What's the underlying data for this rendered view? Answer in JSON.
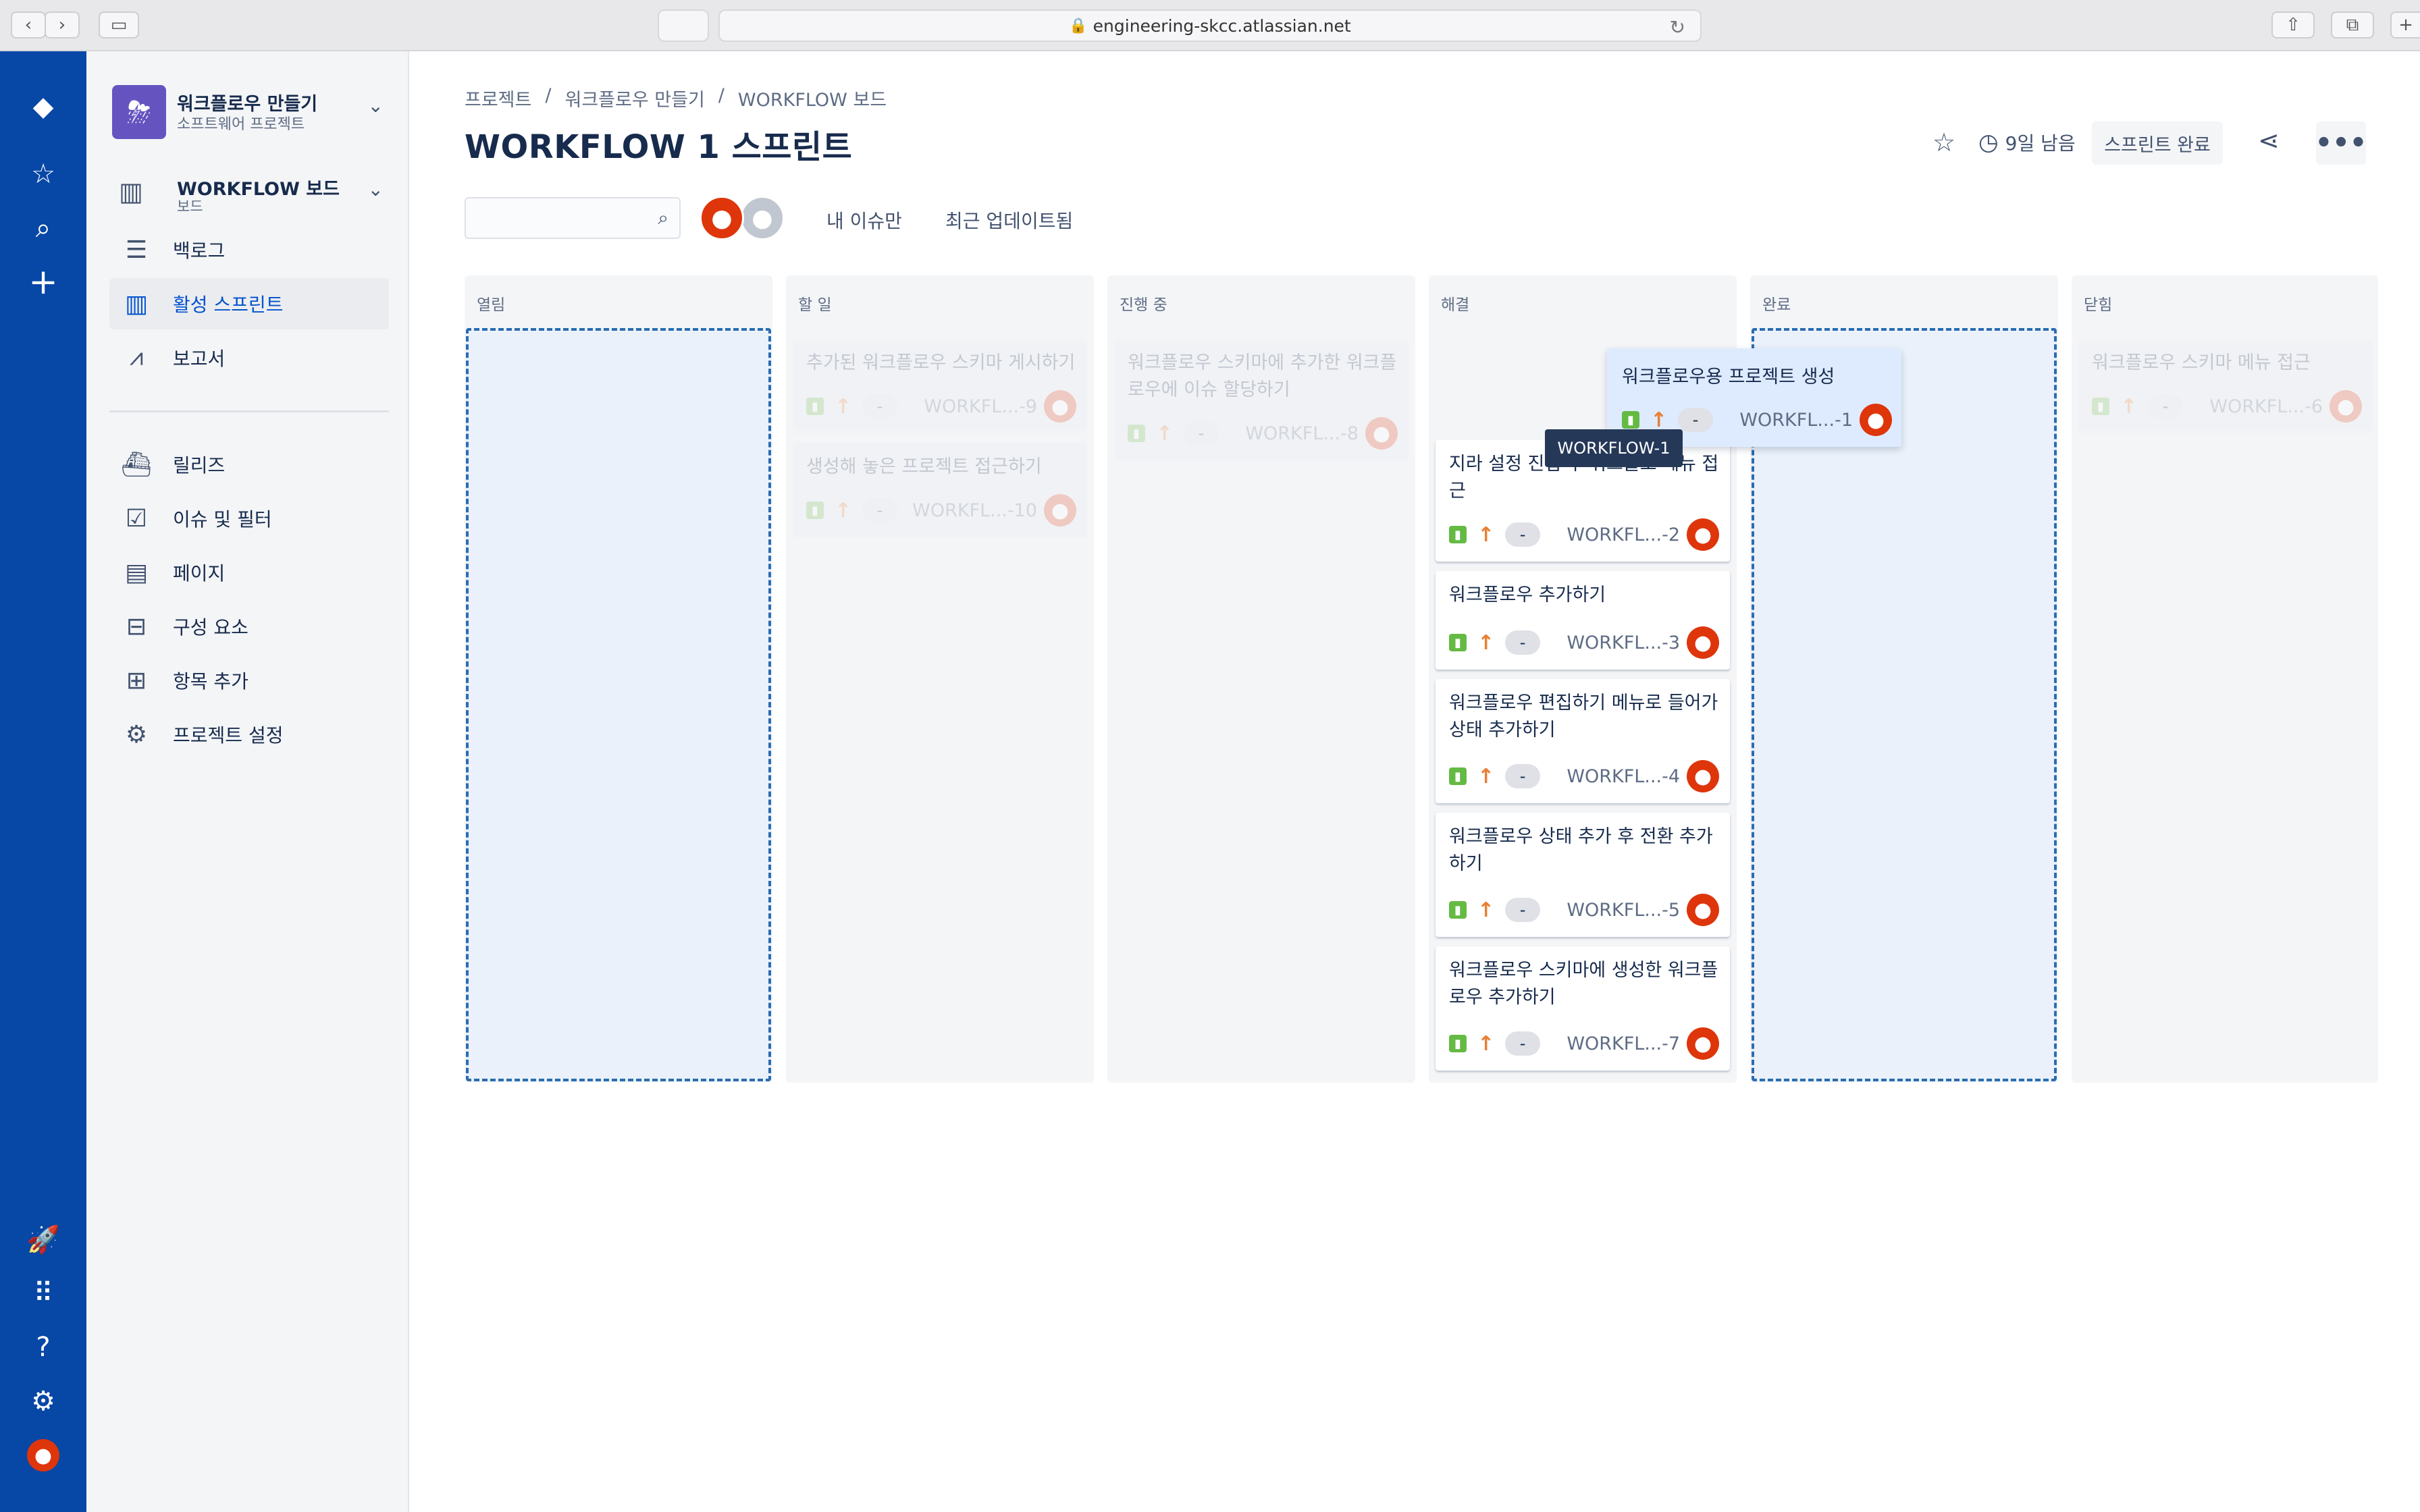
{
  "browser": {
    "url": "engineering-skcc.atlassian.net"
  },
  "sidebar": {
    "project_name": "워크플로우 만들기",
    "project_type": "소프트웨어 프로젝트",
    "board_name": "WORKFLOW 보드",
    "board_sub": "보드",
    "items": [
      {
        "label": "백로그",
        "icon": "backlog-icon"
      },
      {
        "label": "활성 스프린트",
        "icon": "board-icon",
        "active": true
      },
      {
        "label": "보고서",
        "icon": "chart-icon"
      },
      {
        "label": "릴리즈",
        "icon": "ship-icon"
      },
      {
        "label": "이슈 및 필터",
        "icon": "issues-icon"
      },
      {
        "label": "페이지",
        "icon": "page-icon"
      },
      {
        "label": "구성 요소",
        "icon": "component-icon"
      },
      {
        "label": "항목 추가",
        "icon": "add-item-icon"
      },
      {
        "label": "프로젝트 설정",
        "icon": "gear-icon"
      }
    ]
  },
  "breadcrumb": [
    "프로젝트",
    "워크플로우 만들기",
    "WORKFLOW 보드"
  ],
  "page_title": "WORKFLOW 1 스프린트",
  "header": {
    "time_left": "9일 남음",
    "complete_button": "스프린트 완료",
    "more": "•••"
  },
  "filters": {
    "my_issues": "내 이슈만",
    "recently_updated": "최근 업데이트됨"
  },
  "columns": [
    {
      "name": "열림"
    },
    {
      "name": "할 일"
    },
    {
      "name": "진행 중"
    },
    {
      "name": "해결"
    },
    {
      "name": "완료"
    },
    {
      "name": "닫힘"
    }
  ],
  "cards": {
    "todo": [
      {
        "title": "추가된 워크플로우 스키마 게시하기",
        "key": "WORKFL...-9",
        "estimate": "-"
      },
      {
        "title": "생성해 놓은 프로젝트 접근하기",
        "key": "WORKFL...-10",
        "estimate": "-"
      }
    ],
    "inprogress": [
      {
        "title": "워크플로우 스키마에 추가한 워크플로우에 이슈 할당하기",
        "key": "WORKFL...-8",
        "estimate": "-"
      }
    ],
    "resolved": [
      {
        "title": "지라 설정 진입 후 워크플로 메뉴 접근",
        "key": "WORKFL...-2",
        "estimate": "-"
      },
      {
        "title": "워크플로우 추가하기",
        "key": "WORKFL...-3",
        "estimate": "-"
      },
      {
        "title": "워크플로우 편집하기 메뉴로 들어가 상태 추가하기",
        "key": "WORKFL...-4",
        "estimate": "-"
      },
      {
        "title": "워크플로우 상태 추가 후 전환 추가하기",
        "key": "WORKFL...-5",
        "estimate": "-"
      },
      {
        "title": "워크플로우 스키마에 생성한 워크플로우 추가하기",
        "key": "WORKFL...-7",
        "estimate": "-"
      }
    ],
    "closed": [
      {
        "title": "워크플로우 스키마 메뉴 접근",
        "key": "WORKFL...-6",
        "estimate": "-"
      }
    ],
    "dragging": {
      "title": "워크플로우용 프로젝트 생성",
      "key": "WORKFL...-1",
      "estimate": "-"
    }
  },
  "tooltip": "WORKFLOW-1",
  "colors": {
    "nav": "#0747A6",
    "accent": "#0052CC",
    "story": "#65BA43",
    "priority": "#E97F33",
    "avatar": "#DE350B"
  }
}
